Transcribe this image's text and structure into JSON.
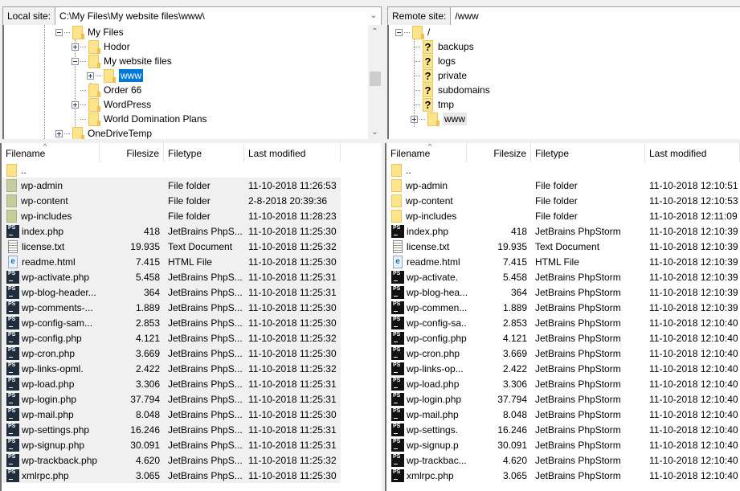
{
  "local": {
    "site_label": "Local site:",
    "path": "C:\\My Files\\My website files\\www\\",
    "tree": [
      {
        "label": "My Files",
        "expander": "minus"
      },
      {
        "label": "Hodor",
        "expander": "plus"
      },
      {
        "label": "My website files",
        "expander": "minus"
      },
      {
        "label": "www",
        "expander": "plus",
        "selected": true
      },
      {
        "label": "Order 66",
        "expander": "none"
      },
      {
        "label": "WordPress",
        "expander": "plus"
      },
      {
        "label": "World Domination Plans",
        "expander": "none"
      },
      {
        "label": "OneDriveTemp",
        "expander": "plus"
      }
    ],
    "columns": {
      "filename": "Filename",
      "filesize": "Filesize",
      "filetype": "Filetype",
      "modified": "Last modified"
    },
    "files": [
      {
        "name": "..",
        "size": "",
        "type": "",
        "modified": "",
        "icon": "folder-up"
      },
      {
        "name": "wp-admin",
        "size": "",
        "type": "File folder",
        "modified": "11-10-2018 11:26:53",
        "icon": "folder"
      },
      {
        "name": "wp-content",
        "size": "",
        "type": "File folder",
        "modified": "2-8-2018 20:39:36",
        "icon": "folder"
      },
      {
        "name": "wp-includes",
        "size": "",
        "type": "File folder",
        "modified": "11-10-2018 11:28:23",
        "icon": "folder"
      },
      {
        "name": "index.php",
        "size": "418",
        "type": "JetBrains PhpS...",
        "modified": "11-10-2018 11:25:30",
        "icon": "php"
      },
      {
        "name": "license.txt",
        "size": "19.935",
        "type": "Text Document",
        "modified": "11-10-2018 11:25:32",
        "icon": "txt"
      },
      {
        "name": "readme.html",
        "size": "7.415",
        "type": "HTML File",
        "modified": "11-10-2018 11:25:30",
        "icon": "html"
      },
      {
        "name": "wp-activate.php",
        "size": "5.458",
        "type": "JetBrains PhpS...",
        "modified": "11-10-2018 11:25:31",
        "icon": "php"
      },
      {
        "name": "wp-blog-header...",
        "size": "364",
        "type": "JetBrains PhpS...",
        "modified": "11-10-2018 11:25:31",
        "icon": "php"
      },
      {
        "name": "wp-comments-...",
        "size": "1.889",
        "type": "JetBrains PhpS...",
        "modified": "11-10-2018 11:25:30",
        "icon": "php"
      },
      {
        "name": "wp-config-sam...",
        "size": "2.853",
        "type": "JetBrains PhpS...",
        "modified": "11-10-2018 11:25:30",
        "icon": "php"
      },
      {
        "name": "wp-config.php",
        "size": "4.121",
        "type": "JetBrains PhpS...",
        "modified": "11-10-2018 11:25:32",
        "icon": "php"
      },
      {
        "name": "wp-cron.php",
        "size": "3.669",
        "type": "JetBrains PhpS...",
        "modified": "11-10-2018 11:25:30",
        "icon": "php"
      },
      {
        "name": "wp-links-opml.",
        "size": "2.422",
        "type": "JetBrains PhpS...",
        "modified": "11-10-2018 11:25:32",
        "icon": "php"
      },
      {
        "name": "wp-load.php",
        "size": "3.306",
        "type": "JetBrains PhpS...",
        "modified": "11-10-2018 11:25:31",
        "icon": "php"
      },
      {
        "name": "wp-login.php",
        "size": "37.794",
        "type": "JetBrains PhpS...",
        "modified": "11-10-2018 11:25:31",
        "icon": "php"
      },
      {
        "name": "wp-mail.php",
        "size": "8.048",
        "type": "JetBrains PhpS...",
        "modified": "11-10-2018 11:25:30",
        "icon": "php"
      },
      {
        "name": "wp-settings.php",
        "size": "16.246",
        "type": "JetBrains PhpS...",
        "modified": "11-10-2018 11:25:31",
        "icon": "php"
      },
      {
        "name": "wp-signup.php",
        "size": "30.091",
        "type": "JetBrains PhpS...",
        "modified": "11-10-2018 11:25:31",
        "icon": "php"
      },
      {
        "name": "wp-trackback.php",
        "size": "4.620",
        "type": "JetBrains PhpS...",
        "modified": "11-10-2018 11:25:32",
        "icon": "php"
      },
      {
        "name": "xmlrpc.php",
        "size": "3.065",
        "type": "JetBrains PhpS...",
        "modified": "11-10-2018 11:25:30",
        "icon": "php"
      }
    ]
  },
  "remote": {
    "site_label": "Remote site:",
    "path": "/www",
    "tree": [
      {
        "label": "/",
        "expander": "minus",
        "icon": "folder"
      },
      {
        "label": "backups",
        "expander": "none",
        "icon": "unknown-folder"
      },
      {
        "label": "logs",
        "expander": "none",
        "icon": "unknown-folder"
      },
      {
        "label": "private",
        "expander": "none",
        "icon": "unknown-folder"
      },
      {
        "label": "subdomains",
        "expander": "none",
        "icon": "unknown-folder"
      },
      {
        "label": "tmp",
        "expander": "none",
        "icon": "unknown-folder"
      },
      {
        "label": "www",
        "expander": "plus",
        "icon": "folder",
        "highlighted": true
      }
    ],
    "columns": {
      "filename": "Filename",
      "filesize": "Filesize",
      "filetype": "Filetype",
      "modified": "Last modified"
    },
    "files": [
      {
        "name": "..",
        "size": "",
        "type": "",
        "modified": "",
        "icon": "folder-up"
      },
      {
        "name": "wp-admin",
        "size": "",
        "type": "File folder",
        "modified": "11-10-2018 12:10:51",
        "icon": "folder"
      },
      {
        "name": "wp-content",
        "size": "",
        "type": "File folder",
        "modified": "11-10-2018 12:10:53",
        "icon": "folder"
      },
      {
        "name": "wp-includes",
        "size": "",
        "type": "File folder",
        "modified": "11-10-2018 12:11:09",
        "icon": "folder"
      },
      {
        "name": "index.php",
        "size": "418",
        "type": "JetBrains PhpStorm",
        "modified": "11-10-2018 12:10:39",
        "icon": "php"
      },
      {
        "name": "license.txt",
        "size": "19.935",
        "type": "Text Document",
        "modified": "11-10-2018 12:10:39",
        "icon": "txt"
      },
      {
        "name": "readme.html",
        "size": "7.415",
        "type": "HTML File",
        "modified": "11-10-2018 12:10:39",
        "icon": "html"
      },
      {
        "name": "wp-activate.",
        "size": "5.458",
        "type": "JetBrains PhpStorm",
        "modified": "11-10-2018 12:10:39",
        "icon": "php"
      },
      {
        "name": "wp-blog-hea...",
        "size": "364",
        "type": "JetBrains PhpStorm",
        "modified": "11-10-2018 12:10:39",
        "icon": "php"
      },
      {
        "name": "wp-commen...",
        "size": "1.889",
        "type": "JetBrains PhpStorm",
        "modified": "11-10-2018 12:10:39",
        "icon": "php"
      },
      {
        "name": "wp-config-sa...",
        "size": "2.853",
        "type": "JetBrains PhpStorm",
        "modified": "11-10-2018 12:10:40",
        "icon": "php"
      },
      {
        "name": "wp-config.php",
        "size": "4.121",
        "type": "JetBrains PhpStorm",
        "modified": "11-10-2018 12:10:40",
        "icon": "php"
      },
      {
        "name": "wp-cron.php",
        "size": "3.669",
        "type": "JetBrains PhpStorm",
        "modified": "11-10-2018 12:10:40",
        "icon": "php"
      },
      {
        "name": "wp-links-op...",
        "size": "2.422",
        "type": "JetBrains PhpStorm",
        "modified": "11-10-2018 12:10:40",
        "icon": "php"
      },
      {
        "name": "wp-load.php",
        "size": "3.306",
        "type": "JetBrains PhpStorm",
        "modified": "11-10-2018 12:10:40",
        "icon": "php"
      },
      {
        "name": "wp-login.php",
        "size": "37.794",
        "type": "JetBrains PhpStorm",
        "modified": "11-10-2018 12:10:40",
        "icon": "php"
      },
      {
        "name": "wp-mail.php",
        "size": "8.048",
        "type": "JetBrains PhpStorm",
        "modified": "11-10-2018 12:10:40",
        "icon": "php"
      },
      {
        "name": "wp-settings.",
        "size": "16.246",
        "type": "JetBrains PhpStorm",
        "modified": "11-10-2018 12:10:40",
        "icon": "php"
      },
      {
        "name": "wp-signup.p",
        "size": "30.091",
        "type": "JetBrains PhpStorm",
        "modified": "11-10-2018 12:10:40",
        "icon": "php"
      },
      {
        "name": "wp-trackbac...",
        "size": "4.620",
        "type": "JetBrains PhpStorm",
        "modified": "11-10-2018 12:10:40",
        "icon": "php"
      },
      {
        "name": "xmlrpc.php",
        "size": "3.065",
        "type": "JetBrains PhpStorm",
        "modified": "11-10-2018 12:10:40",
        "icon": "php"
      }
    ]
  },
  "colors": {
    "selection": "#0078d7",
    "folder": "#fde38a",
    "shaded_row": "#f0f0f0"
  }
}
